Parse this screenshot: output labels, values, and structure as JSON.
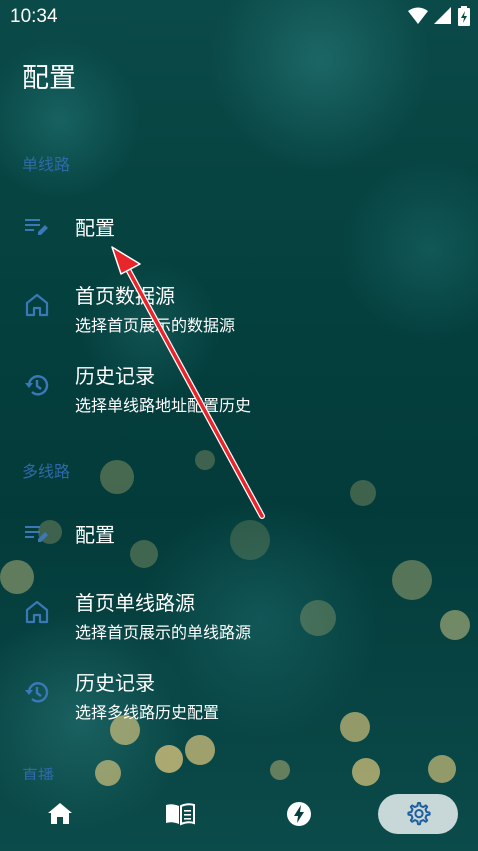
{
  "status_bar": {
    "time": "10:34"
  },
  "page": {
    "title": "配置"
  },
  "sections": [
    {
      "header": "单线路",
      "items": [
        {
          "title": "配置",
          "subtitle": "",
          "icon": "edit-list-icon"
        },
        {
          "title": "首页数据源",
          "subtitle": "选择首页展示的数据源",
          "icon": "home-icon"
        },
        {
          "title": "历史记录",
          "subtitle": "选择单线路地址配置历史",
          "icon": "history-icon"
        }
      ]
    },
    {
      "header": "多线路",
      "items": [
        {
          "title": "配置",
          "subtitle": "",
          "icon": "edit-list-icon"
        },
        {
          "title": "首页单线路源",
          "subtitle": "选择首页展示的单线路源",
          "icon": "home-icon"
        },
        {
          "title": "历史记录",
          "subtitle": "选择多线路历史配置",
          "icon": "history-icon"
        }
      ]
    },
    {
      "header": "直播"
    }
  ],
  "bottom_nav": [
    {
      "icon": "home-icon",
      "active": false
    },
    {
      "icon": "book-icon",
      "active": false
    },
    {
      "icon": "bolt-icon",
      "active": false
    },
    {
      "icon": "gear-icon",
      "active": true
    }
  ],
  "colors": {
    "accent": "#2f6aa8",
    "icon": "#3a78b8",
    "arrow": "#e8252b",
    "nav_active_bg": "#c8d8d8",
    "background": "#05403f"
  }
}
